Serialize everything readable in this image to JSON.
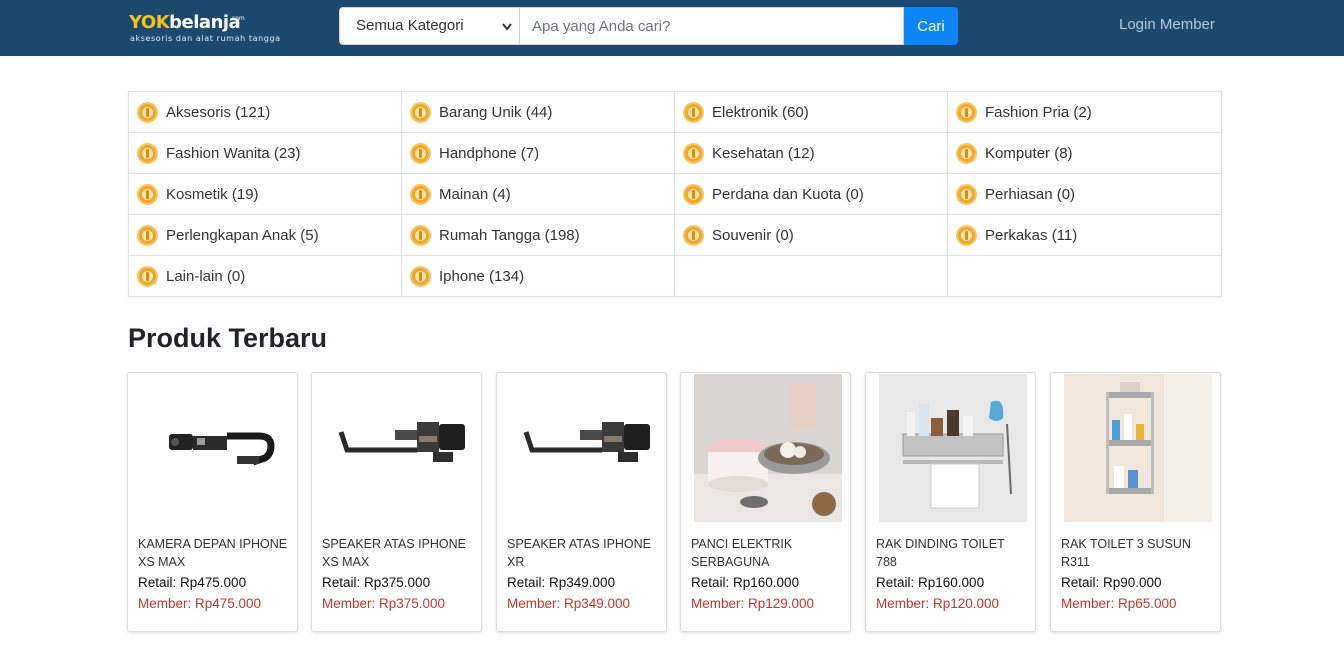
{
  "header": {
    "logo_prefix": "YOK",
    "logo_suffix": "belanja",
    "logo_sup": ".com",
    "logo_tagline": "aksesoris dan alat rumah tangga",
    "category_select_value": "Semua Kategori",
    "search_placeholder": "Apa yang Anda cari?",
    "search_button": "Cari",
    "login_link": "Login Member",
    "bg_color": "#1c4a6e",
    "accent_color": "#0d84f7"
  },
  "categories": [
    {
      "label": "Aksesoris (121)"
    },
    {
      "label": "Barang Unik (44)"
    },
    {
      "label": "Elektronik (60)"
    },
    {
      "label": "Fashion Pria (2)"
    },
    {
      "label": "Fashion Wanita (23)"
    },
    {
      "label": "Handphone (7)"
    },
    {
      "label": "Kesehatan (12)"
    },
    {
      "label": "Komputer (8)"
    },
    {
      "label": "Kosmetik (19)"
    },
    {
      "label": "Mainan (4)"
    },
    {
      "label": "Perdana dan Kuota (0)"
    },
    {
      "label": "Perhiasan (0)"
    },
    {
      "label": "Perlengkapan Anak (5)"
    },
    {
      "label": "Rumah Tangga (198)"
    },
    {
      "label": "Souvenir (0)"
    },
    {
      "label": "Perkakas (11)"
    },
    {
      "label": "Lain-lain (0)"
    },
    {
      "label": "Iphone (134)"
    },
    {
      "label": ""
    },
    {
      "label": ""
    }
  ],
  "section_title": "Produk Terbaru",
  "products": [
    {
      "name": "KAMERA DEPAN IPHONE XS MAX",
      "retail": "Retail: Rp475.000",
      "member": "Member: Rp475.000",
      "image": "camera-flex-cable"
    },
    {
      "name": "SPEAKER ATAS IPHONE XS MAX",
      "retail": "Retail: Rp375.000",
      "member": "Member: Rp375.000",
      "image": "speaker-flex-cable"
    },
    {
      "name": "SPEAKER ATAS IPHONE XR",
      "retail": "Retail: Rp349.000",
      "member": "Member: Rp349.000",
      "image": "speaker-flex-cable"
    },
    {
      "name": "PANCI ELEKTRIK SERBAGUNA",
      "retail": "Retail: Rp160.000",
      "member": "Member: Rp129.000",
      "image": "electric-pot"
    },
    {
      "name": "RAK DINDING TOILET 788",
      "retail": "Retail: Rp160.000",
      "member": "Member: Rp120.000",
      "image": "wall-rack"
    },
    {
      "name": "RAK TOILET 3 SUSUN R311",
      "retail": "Retail: Rp90.000",
      "member": "Member: Rp65.000",
      "image": "toilet-rack"
    }
  ]
}
